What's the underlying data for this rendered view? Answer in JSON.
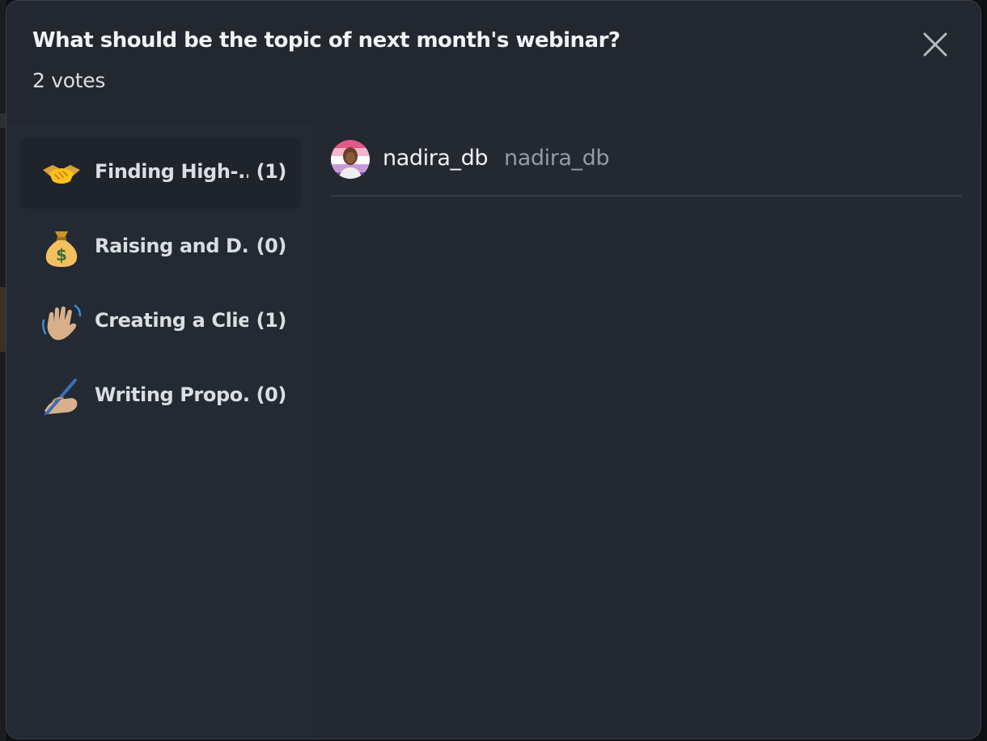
{
  "poll": {
    "title": "What should be the topic of next month's webinar?",
    "votes_label": "2 votes"
  },
  "answers": [
    {
      "label": "Finding High-...",
      "count": "(1)",
      "icon": "handshake-icon",
      "selected": true
    },
    {
      "label": "Raising and D...",
      "count": "(0)",
      "icon": "money-bag-icon",
      "selected": false
    },
    {
      "label": "Creating a Clie...",
      "count": "(1)",
      "icon": "waving-hand-icon",
      "selected": false
    },
    {
      "label": "Writing Propo...",
      "count": "(0)",
      "icon": "writing-hand-icon",
      "selected": false
    }
  ],
  "voters": [
    {
      "display_name": "nadira_db",
      "username": "nadira_db",
      "icon": "avatar"
    }
  ],
  "colors": {
    "modal_bg": "#222730",
    "text_primary": "#f2f3f5",
    "text_muted": "#949ba4",
    "selected_bg": "#1f242c"
  }
}
